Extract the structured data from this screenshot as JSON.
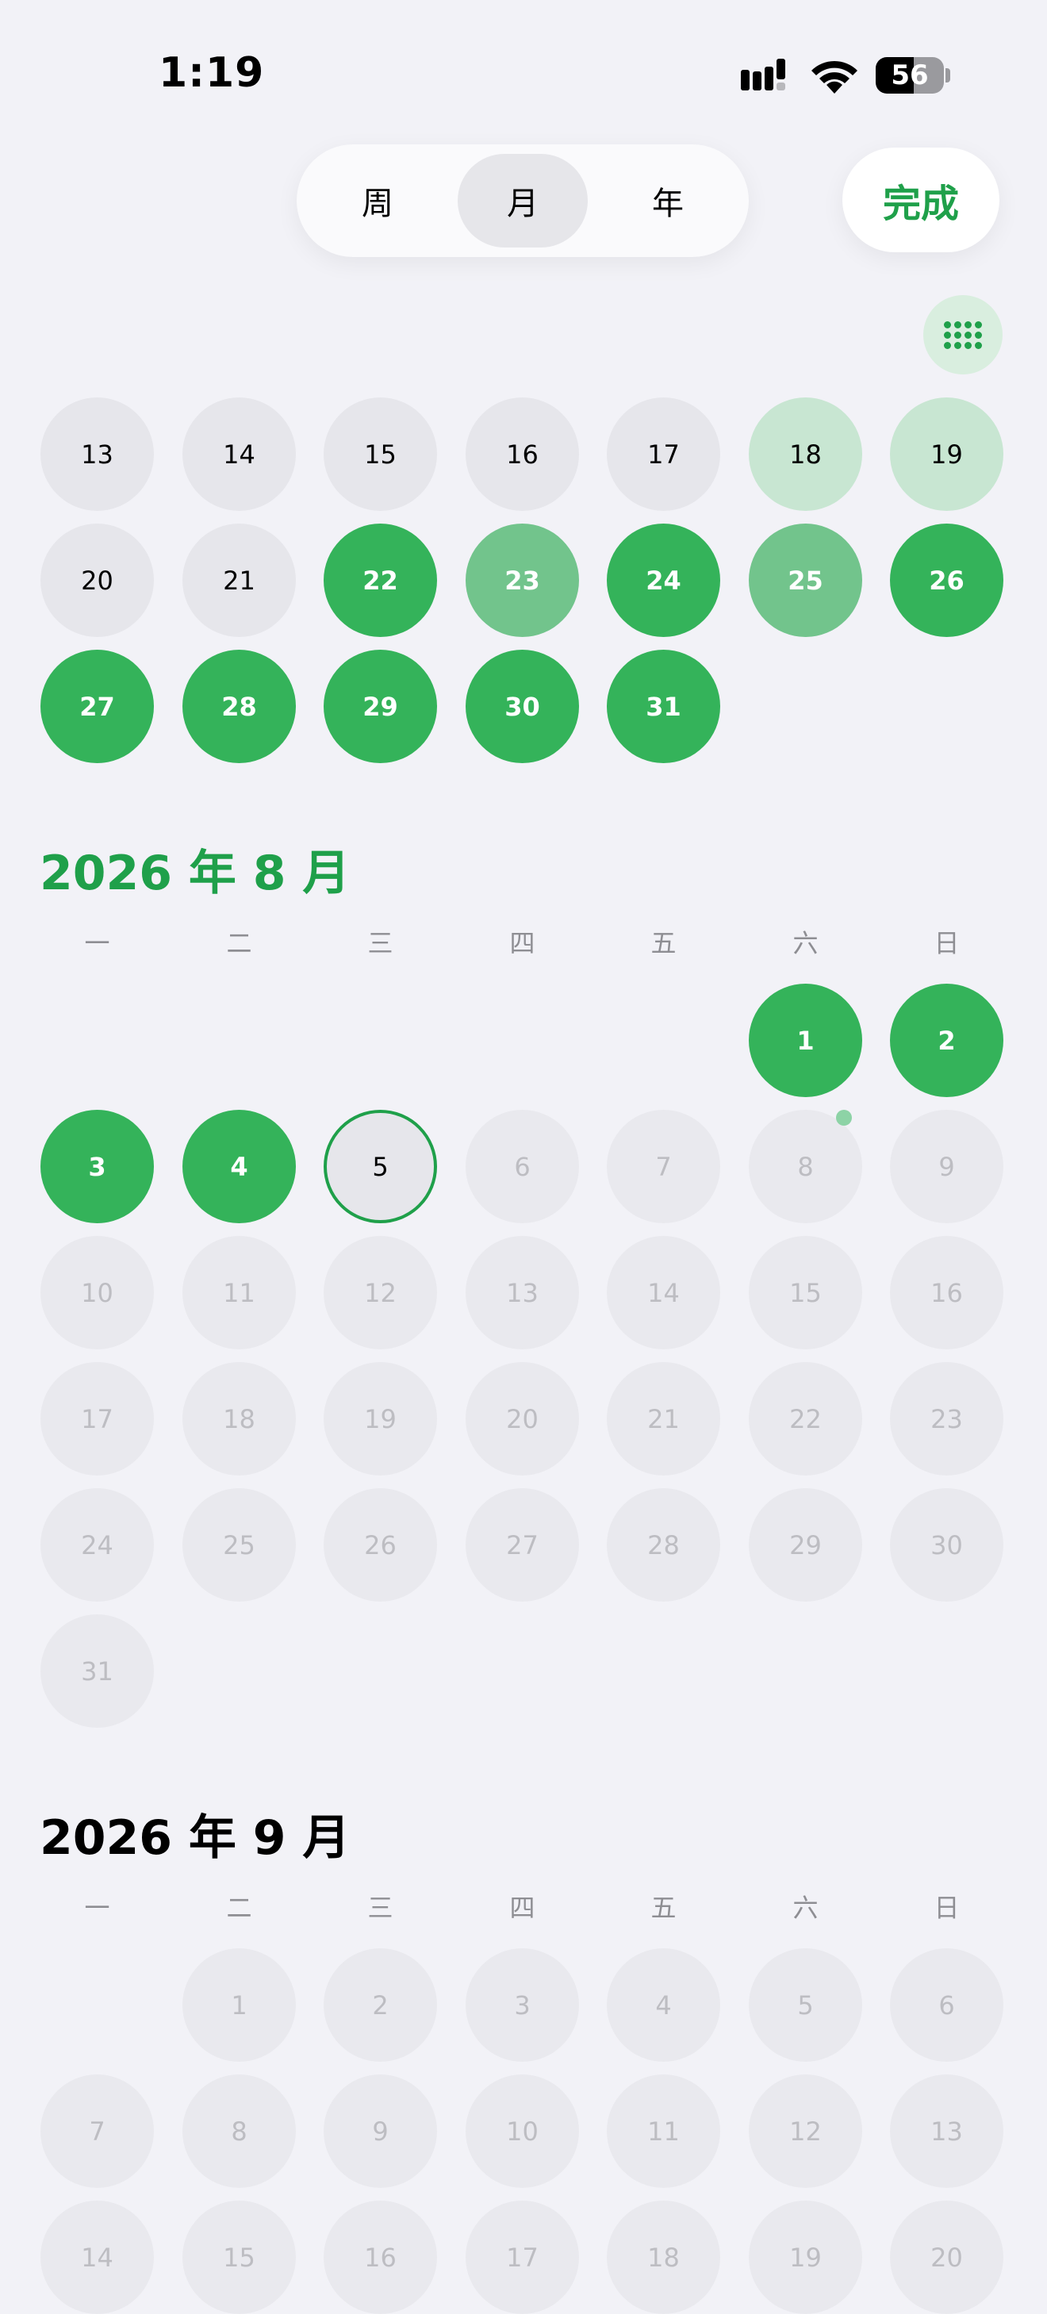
{
  "status_bar": {
    "time": "1:19",
    "battery": "56"
  },
  "view_switcher": {
    "items": [
      "周",
      "月",
      "年"
    ],
    "selected": "月"
  },
  "done_label": "完成",
  "weekdays": [
    "一",
    "二",
    "三",
    "四",
    "五",
    "六",
    "日"
  ],
  "colors": {
    "accent": "#1FA04A",
    "done": "#34B35A",
    "partial": "#72C48C",
    "light": "#C8E6D2"
  },
  "months": [
    {
      "title": "",
      "rows": [
        [
          {
            "d": "13",
            "s": "normal"
          },
          {
            "d": "14",
            "s": "normal"
          },
          {
            "d": "15",
            "s": "normal"
          },
          {
            "d": "16",
            "s": "normal"
          },
          {
            "d": "17",
            "s": "normal"
          },
          {
            "d": "18",
            "s": "light"
          },
          {
            "d": "19",
            "s": "light"
          }
        ],
        [
          {
            "d": "20",
            "s": "normal"
          },
          {
            "d": "21",
            "s": "normal"
          },
          {
            "d": "22",
            "s": "done"
          },
          {
            "d": "23",
            "s": "partial"
          },
          {
            "d": "24",
            "s": "done"
          },
          {
            "d": "25",
            "s": "partial"
          },
          {
            "d": "26",
            "s": "done"
          }
        ],
        [
          {
            "d": "27",
            "s": "done"
          },
          {
            "d": "28",
            "s": "done"
          },
          {
            "d": "29",
            "s": "done"
          },
          {
            "d": "30",
            "s": "done"
          },
          {
            "d": "31",
            "s": "done"
          },
          null,
          null
        ]
      ]
    },
    {
      "title": "2026 年 8 月",
      "current": true,
      "rows": [
        [
          null,
          null,
          null,
          null,
          null,
          {
            "d": "1",
            "s": "done"
          },
          {
            "d": "2",
            "s": "done"
          }
        ],
        [
          {
            "d": "3",
            "s": "done"
          },
          {
            "d": "4",
            "s": "done"
          },
          {
            "d": "5",
            "s": "today"
          },
          {
            "d": "6",
            "s": "dim"
          },
          {
            "d": "7",
            "s": "dim"
          },
          {
            "d": "8",
            "s": "dim",
            "dot": true
          },
          {
            "d": "9",
            "s": "dim"
          }
        ],
        [
          {
            "d": "10",
            "s": "dim"
          },
          {
            "d": "11",
            "s": "dim"
          },
          {
            "d": "12",
            "s": "dim"
          },
          {
            "d": "13",
            "s": "dim"
          },
          {
            "d": "14",
            "s": "dim"
          },
          {
            "d": "15",
            "s": "dim"
          },
          {
            "d": "16",
            "s": "dim"
          }
        ],
        [
          {
            "d": "17",
            "s": "dim"
          },
          {
            "d": "18",
            "s": "dim"
          },
          {
            "d": "19",
            "s": "dim"
          },
          {
            "d": "20",
            "s": "dim"
          },
          {
            "d": "21",
            "s": "dim"
          },
          {
            "d": "22",
            "s": "dim"
          },
          {
            "d": "23",
            "s": "dim"
          }
        ],
        [
          {
            "d": "24",
            "s": "dim"
          },
          {
            "d": "25",
            "s": "dim"
          },
          {
            "d": "26",
            "s": "dim"
          },
          {
            "d": "27",
            "s": "dim"
          },
          {
            "d": "28",
            "s": "dim"
          },
          {
            "d": "29",
            "s": "dim"
          },
          {
            "d": "30",
            "s": "dim"
          }
        ],
        [
          {
            "d": "31",
            "s": "dim"
          },
          null,
          null,
          null,
          null,
          null,
          null
        ]
      ]
    },
    {
      "title": "2026 年 9 月",
      "rows": [
        [
          null,
          {
            "d": "1",
            "s": "dim"
          },
          {
            "d": "2",
            "s": "dim"
          },
          {
            "d": "3",
            "s": "dim"
          },
          {
            "d": "4",
            "s": "dim"
          },
          {
            "d": "5",
            "s": "dim"
          },
          {
            "d": "6",
            "s": "dim"
          }
        ],
        [
          {
            "d": "7",
            "s": "dim"
          },
          {
            "d": "8",
            "s": "dim"
          },
          {
            "d": "9",
            "s": "dim"
          },
          {
            "d": "10",
            "s": "dim"
          },
          {
            "d": "11",
            "s": "dim"
          },
          {
            "d": "12",
            "s": "dim"
          },
          {
            "d": "13",
            "s": "dim"
          }
        ],
        [
          {
            "d": "14",
            "s": "dim"
          },
          {
            "d": "15",
            "s": "dim"
          },
          {
            "d": "16",
            "s": "dim"
          },
          {
            "d": "17",
            "s": "dim"
          },
          {
            "d": "18",
            "s": "dim"
          },
          {
            "d": "19",
            "s": "dim"
          },
          {
            "d": "20",
            "s": "dim"
          }
        ]
      ]
    }
  ]
}
